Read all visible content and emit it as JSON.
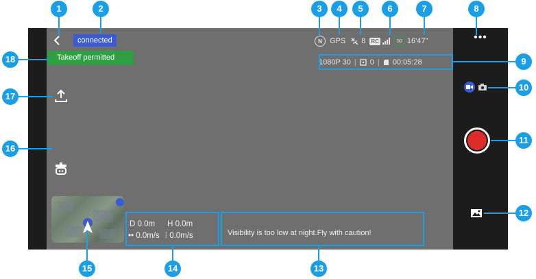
{
  "topbar": {
    "connection_status": "connected",
    "takeoff_status": "Takeoff permitted",
    "flight_mode": "N",
    "gps_label": "GPS",
    "satellites": "8",
    "rc_label": "RC",
    "battery_percent": "50",
    "flight_time": "16'47\""
  },
  "recording": {
    "resolution": "1080P 30",
    "photo_count": "0",
    "storage_remaining": "00:05:28"
  },
  "telemetry": {
    "distance": "D 0.0m",
    "height": "H 0.0m",
    "horizontal_speed": "0.0m/s",
    "vertical_speed": "0.0m/s"
  },
  "warning": "Visibility is too low at night.Fly with caution!",
  "icons": {
    "back": "chevron-left-icon",
    "more": "more-dots-icon",
    "takeoff": "takeoff-icon",
    "robot": "robot-icon",
    "video_mode": "video-camera-icon",
    "photo_mode": "camera-icon",
    "record": "record-icon",
    "gallery": "gallery-icon",
    "map_pin": "location-pin-icon"
  },
  "colors": {
    "accent_callout": "#1a9ee6",
    "connected_badge": "#3b5bd6",
    "takeoff_banner": "#2ea043",
    "record_button": "#e02b2b",
    "frame_bg": "#6f6f6f",
    "panel_bg": "#1c1c1c"
  },
  "callouts": [
    "1",
    "2",
    "3",
    "4",
    "5",
    "6",
    "7",
    "8",
    "9",
    "10",
    "11",
    "12",
    "13",
    "14",
    "15",
    "16",
    "17",
    "18"
  ]
}
